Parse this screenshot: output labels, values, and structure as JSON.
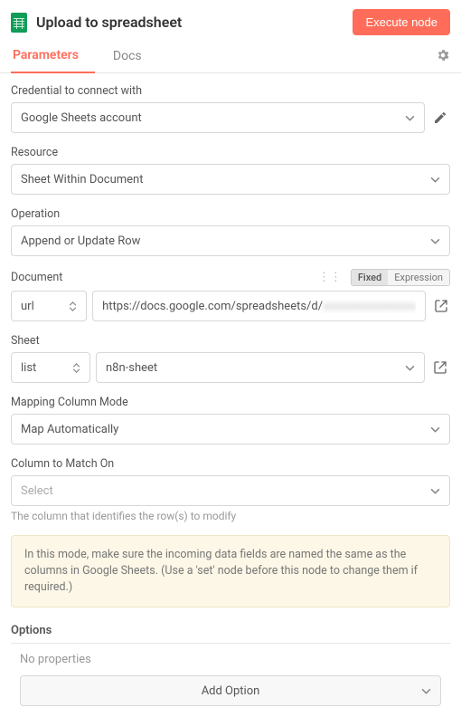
{
  "header": {
    "title": "Upload to spreadsheet",
    "execute_label": "Execute node"
  },
  "tabs": {
    "parameters": "Parameters",
    "docs": "Docs"
  },
  "fields": {
    "credential": {
      "label": "Credential to connect with",
      "value": "Google Sheets account"
    },
    "resource": {
      "label": "Resource",
      "value": "Sheet Within Document"
    },
    "operation": {
      "label": "Operation",
      "value": "Append or Update Row"
    },
    "document": {
      "label": "Document",
      "mode": "url",
      "value": "https://docs.google.com/spreadsheets/d/",
      "blurred_tail": "xxxxxxxxxxxxxxxx",
      "toggle_fixed": "Fixed",
      "toggle_expr": "Expression"
    },
    "sheet": {
      "label": "Sheet",
      "mode": "list",
      "value": "n8n-sheet"
    },
    "mapping": {
      "label": "Mapping Column Mode",
      "value": "Map Automatically"
    },
    "match": {
      "label": "Column to Match On",
      "placeholder": "Select",
      "helper": "The column that identifies the row(s) to modify"
    }
  },
  "info": "In this mode, make sure the incoming data fields are named the same as the columns in Google Sheets. (Use a 'set' node before this node to change them if required.)",
  "options": {
    "title": "Options",
    "no_props": "No properties",
    "add_option": "Add Option"
  }
}
